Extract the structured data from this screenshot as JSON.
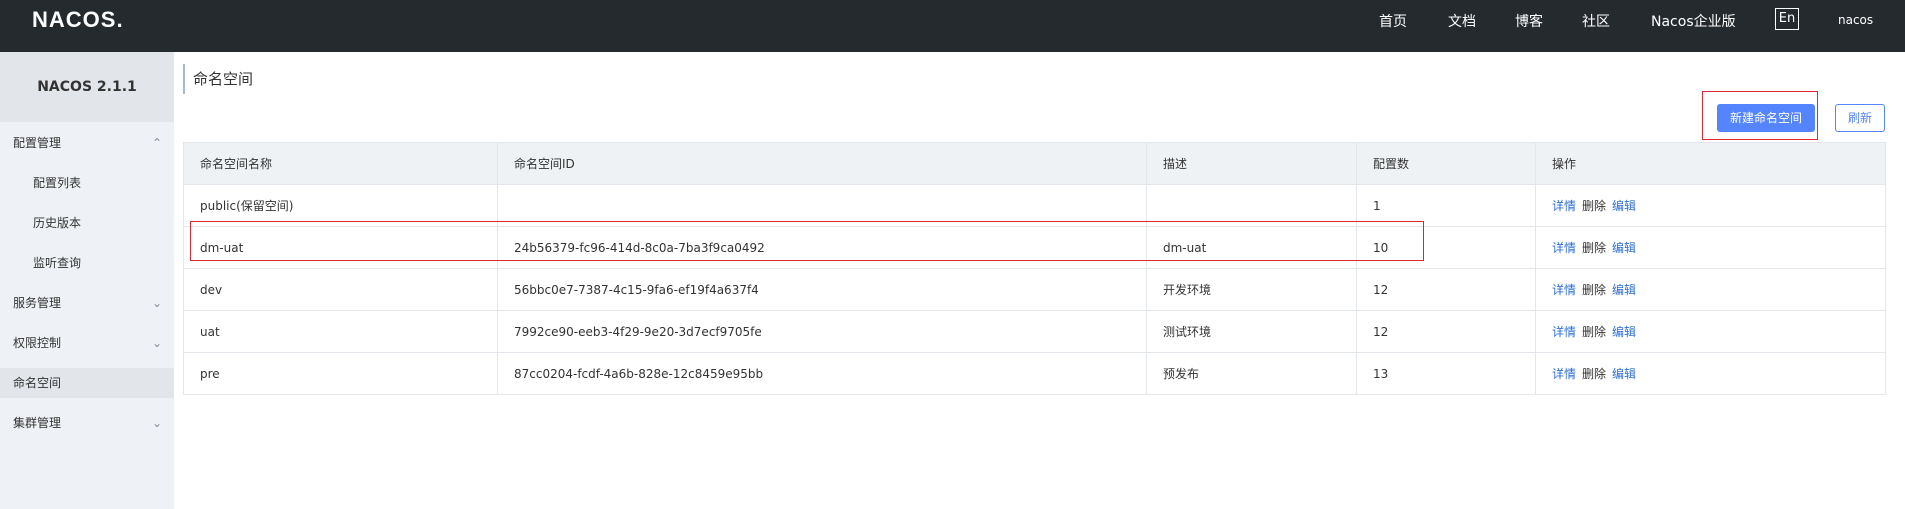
{
  "header": {
    "logo": "NACOS.",
    "nav": [
      "首页",
      "文档",
      "博客",
      "社区",
      "Nacos企业版"
    ],
    "lang": "En",
    "user": "nacos"
  },
  "sidebar": {
    "version": "NACOS 2.1.1",
    "items": [
      {
        "label": "配置管理"
      },
      {
        "label": "配置列表"
      },
      {
        "label": "历史版本"
      },
      {
        "label": "监听查询"
      },
      {
        "label": "服务管理"
      },
      {
        "label": "权限控制"
      },
      {
        "label": "命名空间"
      },
      {
        "label": "集群管理"
      }
    ]
  },
  "main": {
    "title": "命名空间",
    "new_button": "新建命名空间",
    "refresh_button": "刷新",
    "table": {
      "headers": [
        "命名空间名称",
        "命名空间ID",
        "描述",
        "配置数",
        "操作"
      ],
      "rows": [
        {
          "name": "public(保留空间)",
          "id": "",
          "desc": "",
          "count": "1"
        },
        {
          "name": "dm-uat",
          "id": "24b56379-fc96-414d-8c0a-7ba3f9ca0492",
          "desc": "dm-uat",
          "count": "10"
        },
        {
          "name": "dev",
          "id": "56bbc0e7-7387-4c15-9fa6-ef19f4a637f4",
          "desc": "开发环境",
          "count": "12"
        },
        {
          "name": "uat",
          "id": "7992ce90-eeb3-4f29-9e20-3d7ecf9705fe",
          "desc": "测试环境",
          "count": "12"
        },
        {
          "name": "pre",
          "id": "87cc0204-fcdf-4a6b-828e-12c8459e95bb",
          "desc": "预发布",
          "count": "13"
        }
      ],
      "actions": {
        "detail": "详情",
        "delete": "删除",
        "edit": "编辑"
      }
    }
  },
  "colors": {
    "topbar": "#252a2f",
    "primary": "#5584ff",
    "link": "#2e6fd6",
    "highlight": "#e0262e"
  }
}
